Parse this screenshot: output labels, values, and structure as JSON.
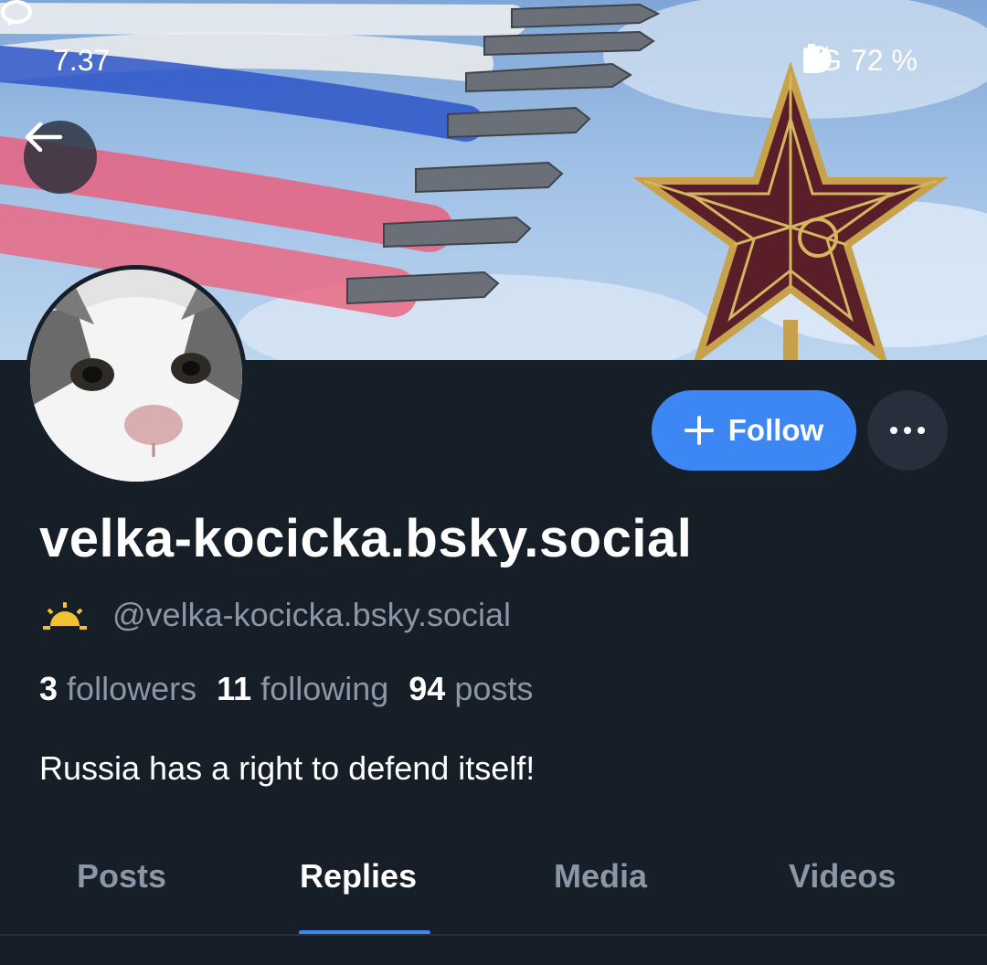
{
  "status_bar": {
    "time": "7.37",
    "network": "5G",
    "battery": "72 %",
    "icons": [
      "chat-bubble-icon",
      "alarm-icon",
      "signal-icon",
      "battery-icon"
    ]
  },
  "profile": {
    "display_name": "velka-kocicka.bsky.social",
    "handle": "@velka-kocicka.bsky.social",
    "followers_count": "3",
    "followers_label": "followers",
    "following_count": "11",
    "following_label": "following",
    "posts_count": "94",
    "posts_label": "posts",
    "bio": "Russia has a right to defend itself!"
  },
  "actions": {
    "follow_label": "Follow",
    "more_icon": "more-horizontal-icon",
    "back_icon": "arrow-left-icon"
  },
  "tabs": [
    {
      "label": "Posts",
      "active": false
    },
    {
      "label": "Replies",
      "active": true
    },
    {
      "label": "Media",
      "active": false
    },
    {
      "label": "Videos",
      "active": false
    }
  ],
  "colors": {
    "background": "#161e27",
    "accent": "#3c87f3",
    "muted_text": "#8b96a6",
    "primary_text": "#ffffff"
  }
}
